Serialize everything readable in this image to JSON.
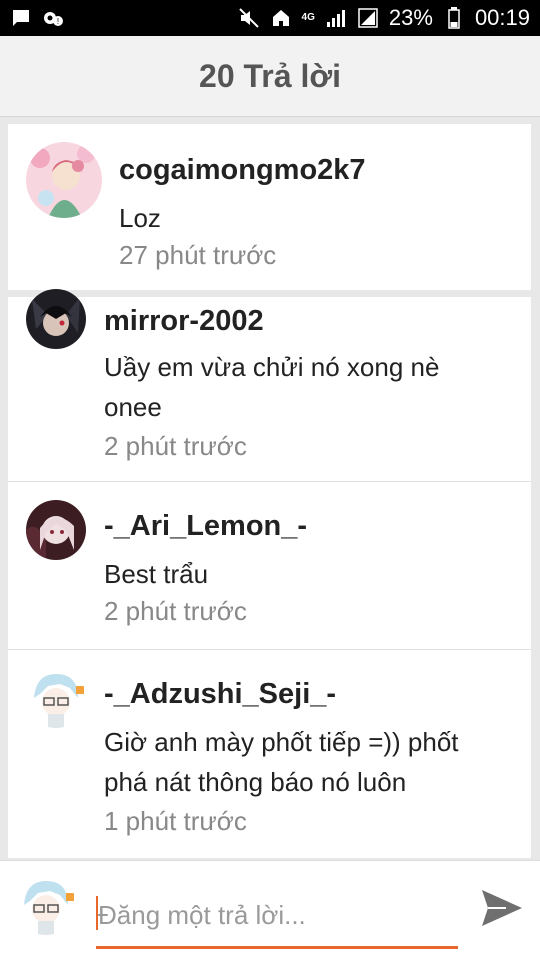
{
  "status_bar": {
    "battery": "23%",
    "time": "00:19",
    "network": "4G",
    "icons_left": [
      "message-icon",
      "settings-notification-icon"
    ],
    "icons_right": [
      "mute-icon",
      "home-icon",
      "signal-icon",
      "battery-icon"
    ]
  },
  "header": {
    "title": "20 Trả lời"
  },
  "replies": [
    {
      "username": "cogaimongmo2k7",
      "message": "Loz",
      "time": "27 phút trước"
    },
    {
      "username": "mirror-2002",
      "message": "Uầy em vừa chửi nó xong nè onee",
      "time": "2 phút trước"
    },
    {
      "username": "-_Ari_Lemon_-",
      "message": "Best trẩu",
      "time": "2 phút trước"
    },
    {
      "username": "-_Adzushi_Seji_-",
      "message": "Giờ anh mày phốt tiếp =)) phốt phá nát thông báo nó luôn",
      "time": "1 phút trước"
    }
  ],
  "reply_bar": {
    "placeholder": "Đăng một trả lời..."
  },
  "colors": {
    "accent": "#e8672d",
    "header_bg": "#f2f2f2",
    "status_bar_bg": "#000000"
  }
}
